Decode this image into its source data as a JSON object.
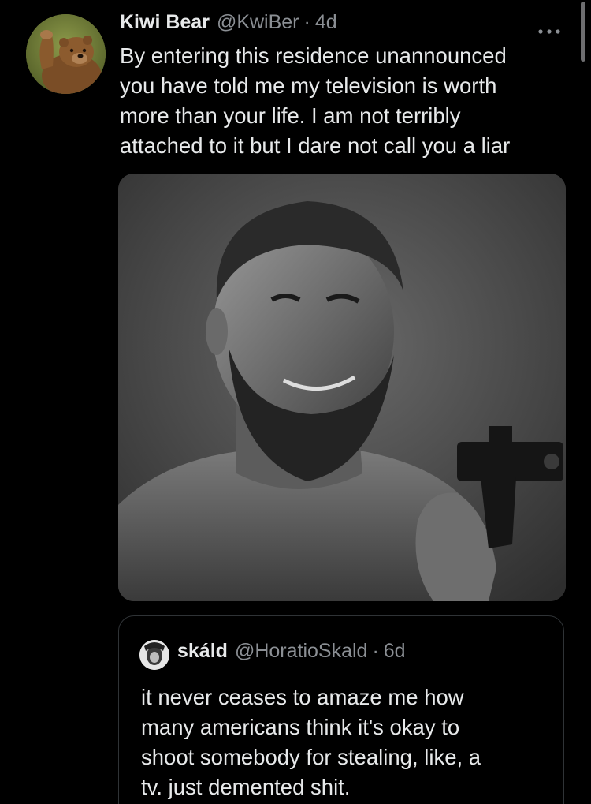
{
  "tweet": {
    "author_name": "Kiwi Bear",
    "author_handle": "@KwiBer",
    "separator": "·",
    "age": "4d",
    "avatar_icon": "bear-avatar",
    "more_icon": "more-options-icon",
    "text_lines": [
      "By entering this residence unannounced",
      "you have told me my television is worth",
      "more than your life. I am not terribly",
      "attached to it but I dare not call you a liar"
    ]
  },
  "media": {
    "image_icon": "meme-photo-man-with-pistol"
  },
  "quoted_tweet": {
    "author_name": "skáld",
    "author_handle": "@HoratioSkald",
    "separator": "·",
    "age": "6d",
    "avatar_icon": "quoted-avatar",
    "text_lines": [
      "it never ceases to amaze me how",
      "many americans think it's okay to",
      "shoot somebody for stealing, like, a",
      "tv. just demented shit."
    ]
  },
  "colors": {
    "background": "#000000",
    "primary_text": "#e7e9ea",
    "secondary_text": "#8b8f94",
    "border": "#2f3336"
  }
}
